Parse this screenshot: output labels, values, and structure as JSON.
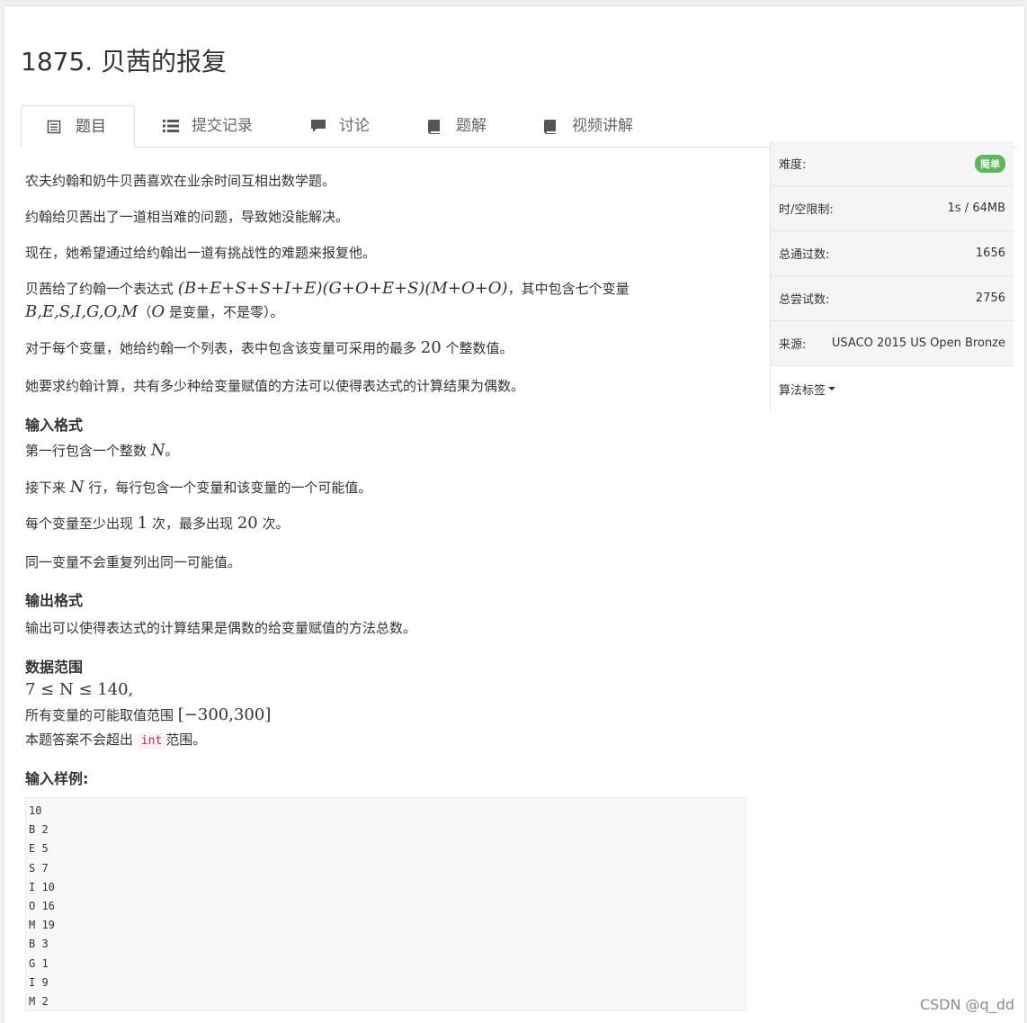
{
  "problem": {
    "title": "1875. 贝茜的报复"
  },
  "tabs": [
    {
      "label": "题目",
      "icon": "document-list-icon"
    },
    {
      "label": "提交记录",
      "icon": "list-icon"
    },
    {
      "label": "讨论",
      "icon": "comment-icon"
    },
    {
      "label": "题解",
      "icon": "book-icon"
    },
    {
      "label": "视频讲解",
      "icon": "book-icon"
    }
  ],
  "content": {
    "p1": "农夫约翰和奶牛贝茜喜欢在业余时间互相出数学题。",
    "p2": "约翰给贝茜出了一道相当难的问题，导致她没能解决。",
    "p3": "现在，她希望通过给约翰出一道有挑战性的难题来报复他。",
    "p4_a": "贝茜给了约翰一个表达式",
    "p4_expr": "(B+E+S+S+I+E)(G+O+E+S)(M+O+O)",
    "p4_b": "，其中包含七个变量",
    "p4_vars": "B,E,S,I,G,O,M",
    "p4_c": "（",
    "p4_o": "O",
    "p4_d": "是变量，不是零）。",
    "p5_a": "对于每个变量，她给约翰一个列表，表中包含该变量可采用的最多",
    "p5_n": "20",
    "p5_b": "个整数值。",
    "p6": "她要求约翰计算，共有多少种给变量赋值的方法可以使得表达式的计算结果为偶数。",
    "input_heading": "输入格式",
    "in1_a": "第一行包含一个整数",
    "in1_n": "N",
    "in1_b": "。",
    "in2_a": "接下来",
    "in2_n": "N",
    "in2_b": "行，每行包含一个变量和该变量的一个可能值。",
    "in3_a": "每个变量至少出现",
    "in3_n1": "1",
    "in3_b": "次，最多出现",
    "in3_n2": "20",
    "in3_c": "次。",
    "in4": "同一变量不会重复列出同一可能值。",
    "output_heading": "输出格式",
    "out1": "输出可以使得表达式的计算结果是偶数的给变量赋值的方法总数。",
    "range_heading": "数据范围",
    "range1": "7 ≤ N ≤ 140,",
    "range2_a": "所有变量的可能取值范围",
    "range2_b": "[−300,300]",
    "range3_a": "本题答案不会超出",
    "range3_code": "int",
    "range3_b": "范围。",
    "sample_heading": "输入样例:",
    "sample_input": "10\nB 2\nE 5\nS 7\nI 10\nO 16\nM 19\nB 3\nG 1\nI 9\nM 2"
  },
  "sidebar": {
    "difficulty_label": "难度:",
    "difficulty_value": "简单",
    "limit_label": "时/空限制:",
    "limit_value": "1s / 64MB",
    "passed_label": "总通过数:",
    "passed_value": "1656",
    "tried_label": "总尝试数:",
    "tried_value": "2756",
    "source_label": "来源:",
    "source_value": "USACO 2015 US Open Bronze",
    "tags_label": "算法标签"
  },
  "watermark": "CSDN @q_dd",
  "colors": {
    "badge": "#5cb85c",
    "code": "#c7254e"
  }
}
